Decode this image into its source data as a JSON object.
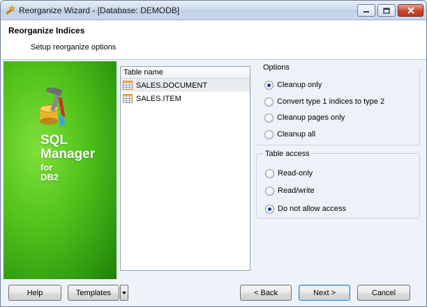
{
  "window": {
    "title": "Reorganize Wizard - [Database: DEMODB]"
  },
  "header": {
    "title": "Reorganize Indices",
    "subtitle": "Setup reorganize options"
  },
  "banner": {
    "line1": "SQL",
    "line2": "Manager",
    "line3": "for",
    "line4": "DB2",
    "color": "#4fc01a"
  },
  "table_list": {
    "column": "Table name",
    "rows": [
      "SALES.DOCUMENT",
      "SALES.ITEM"
    ],
    "selected_index": 0
  },
  "options": {
    "title": "Options",
    "items": [
      "Cleanup only",
      "Convert type 1 indices to type 2",
      "Cleanup pages only",
      "Cleanup all"
    ],
    "selected_index": 0
  },
  "table_access": {
    "title": "Table access",
    "items": [
      "Read-only",
      "Read/write",
      "Do not allow access"
    ],
    "selected_index": 2
  },
  "buttons": {
    "help": "Help",
    "templates": "Templates",
    "back": "< Back",
    "next": "Next >",
    "cancel": "Cancel"
  }
}
